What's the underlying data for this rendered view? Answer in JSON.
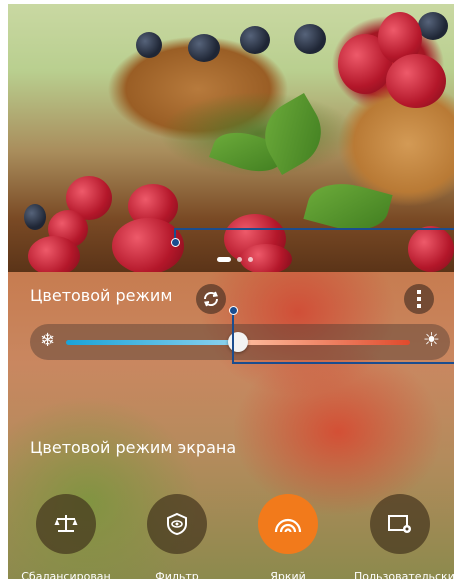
{
  "pager": {
    "count": 3,
    "active": 0
  },
  "color_mode": {
    "title": "Цветовой режим",
    "refresh_icon": "refresh-icon",
    "menu_icon": "more-vertical-icon"
  },
  "temperature_slider": {
    "cold_icon": "snowflake-icon",
    "warm_icon": "sun-icon",
    "value_percent": 50
  },
  "screen_mode": {
    "title": "Цветовой режим экрана",
    "modes": [
      {
        "label": "Сбалансирован",
        "icon": "scale-icon",
        "active": false
      },
      {
        "label": "Фильтр",
        "icon": "eye-shield-icon",
        "active": false
      },
      {
        "label": "Яркий",
        "icon": "rainbow-icon",
        "active": true
      },
      {
        "label": "Пользовательский",
        "icon": "custom-display-icon",
        "active": false
      }
    ]
  },
  "colors": {
    "accent": "#f27a1b",
    "annotation": "#1b4d8f"
  }
}
